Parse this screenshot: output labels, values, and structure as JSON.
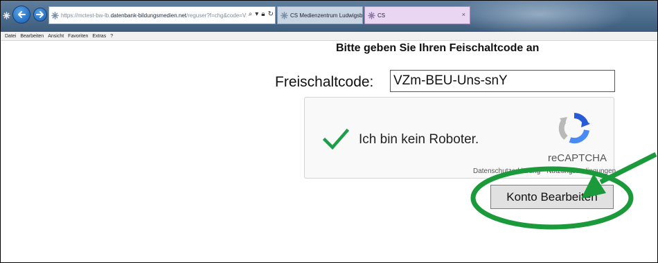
{
  "browser": {
    "url_prefix": "https://mctest-bw-lb.",
    "url_host": "datenbank-bildungsmedien.net",
    "url_path": "/reguser?f=chg&code=V2",
    "tabs": [
      {
        "label": "CS Medienzentrum Ludwigsbu..."
      },
      {
        "label": "CS",
        "close": "×"
      }
    ],
    "menu": [
      "Datei",
      "Bearbeiten",
      "Ansicht",
      "Favoriten",
      "Extras",
      "?"
    ]
  },
  "page": {
    "heading": "Bitte geben Sie Ihren Feischaltcode an",
    "code_label": "Freischaltcode:",
    "code_value": "VZm-BEU-Uns-snY"
  },
  "captcha": {
    "label": "Ich bin kein Roboter.",
    "brand": "reCAPTCHA",
    "links": "Datenschutzerklärung - Nutzungsbedingungen",
    "checked": true
  },
  "submit": {
    "label": "Konto Bearbeiten"
  },
  "annotation": {
    "color": "#1a9a3a"
  },
  "colors": {
    "titlebar": "#4c6c8c",
    "check": "#1e9e4a"
  }
}
